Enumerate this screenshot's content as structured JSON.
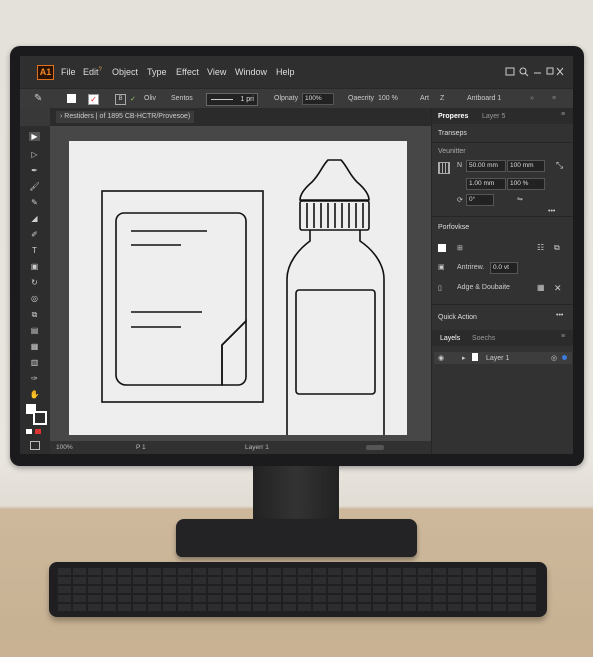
{
  "app": {
    "logo": "A1"
  },
  "menu": [
    "File",
    "Edit",
    "Object",
    "Type",
    "Effect",
    "View",
    "Window",
    "Help"
  ],
  "menu_edit_sup": "?",
  "control_bar": {
    "style_label": "Oliv",
    "style_value": "Sentos",
    "stroke_value": "1 pri",
    "opacity_label": "Olpnaty",
    "opacity_value": "100%",
    "opacity_right_label": "Qaecrity",
    "opacity_right_value": "100 %",
    "art_label": "Art",
    "z_label": "Z",
    "artboard_label": "Antboard 1"
  },
  "document_tab": {
    "title": "Restiders | of 1895 CB-HCTR/Provesoe)"
  },
  "status_bar": {
    "zoom": "100%",
    "page": "P 1",
    "layer": "Layerr 1"
  },
  "panel": {
    "tabs": [
      "Properes",
      "Layer 5"
    ],
    "transform_heading": "Transeps",
    "transform_sub": "Veunitter",
    "w_label": "N",
    "w_value": "50.00 mm",
    "h_value": "100 mm",
    "x_value": "1.00 mm",
    "y_value": "100 %",
    "angle_value": "0°",
    "appearance_heading": "Porfovkse",
    "stroke_label": "Antrirew.",
    "stroke_value": "0.0 vt",
    "align_label": "Adge & Doubaite",
    "quick_actions": "Quick Action",
    "layers_tabs": [
      "Layels",
      "Soechs"
    ],
    "layer_name": "Layer 1"
  },
  "colors": {
    "accent": "#f48b29",
    "ui_dark": "#2f2f2f",
    "artboard": "#eeeeee"
  },
  "icons": [
    "pencil-icon",
    "selection-icon",
    "direct-selection-icon",
    "pen-icon",
    "brush-icon",
    "eraser-icon",
    "type-icon",
    "rotate-icon",
    "shape-icon",
    "scale-icon",
    "gradient-icon",
    "eyedropper-icon",
    "hand-icon",
    "zoom-icon",
    "search-icon",
    "minimize-icon",
    "maximize-icon",
    "close-icon",
    "eye-icon",
    "lock-icon"
  ]
}
